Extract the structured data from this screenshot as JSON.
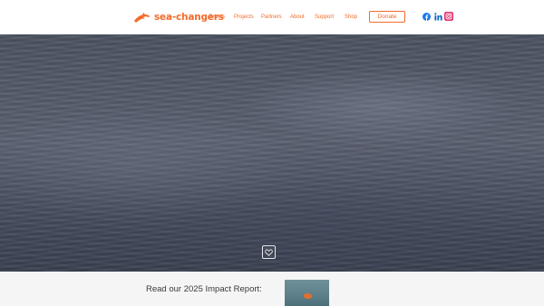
{
  "header": {
    "logo_text": "sea-changers",
    "nav": [
      "Grants",
      "Projects",
      "Partners",
      "About",
      "Support",
      "Shop"
    ],
    "donate_label": "Donate",
    "social": [
      "facebook-icon",
      "linkedin-icon",
      "instagram-icon"
    ]
  },
  "hero": {
    "like_icon": "heart-icon"
  },
  "impact": {
    "text": "Read our 2025 Impact Report:"
  },
  "colors": {
    "brand_orange": "#f26b2a",
    "facebook_blue": "#1877f2",
    "linkedin_blue": "#0a66c2",
    "instagram_pink": "#e1306c",
    "impact_bg": "#f5f5f5"
  }
}
